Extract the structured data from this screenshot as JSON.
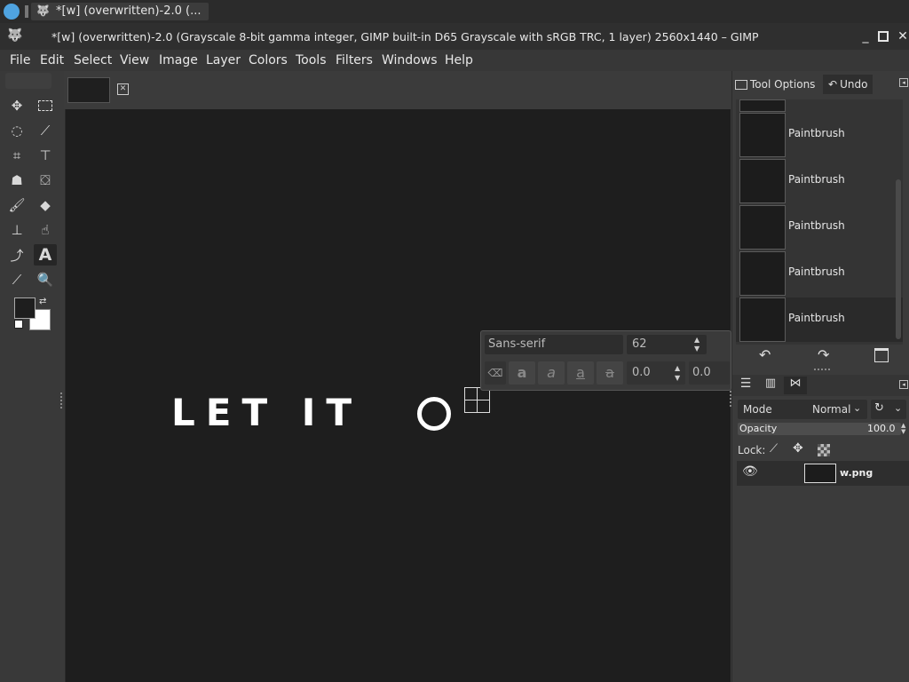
{
  "taskbar": {
    "window_button_label": "*[w] (overwritten)-2.0 (..."
  },
  "titlebar": {
    "title": "*[w] (overwritten)-2.0 (Grayscale 8-bit gamma integer, GIMP built-in D65 Grayscale with sRGB TRC, 1 layer) 2560x1440 – GIMP"
  },
  "menubar": {
    "items": [
      "File",
      "Edit",
      "Select",
      "View",
      "Image",
      "Layer",
      "Colors",
      "Tools",
      "Filters",
      "Windows",
      "Help"
    ]
  },
  "canvas": {
    "text": "LET IT",
    "letter": "O"
  },
  "text_tool": {
    "font": "Sans-serif",
    "size": "62",
    "baseline": "0.0",
    "kerning": "0.0"
  },
  "right_dock": {
    "tabs": [
      "Tool Options",
      "Undo"
    ],
    "undo_items": [
      "Paintbrush",
      "Paintbrush",
      "Paintbrush",
      "Paintbrush",
      "Paintbrush"
    ],
    "layers": {
      "mode_label": "Mode",
      "mode_value": "Normal",
      "opacity_label": "Opacity",
      "opacity_value": "100.0",
      "lock_label": "Lock:",
      "layer_name": "w.png"
    }
  },
  "colors": {
    "fg": "#1e1e1e",
    "bg": "#ffffff"
  }
}
